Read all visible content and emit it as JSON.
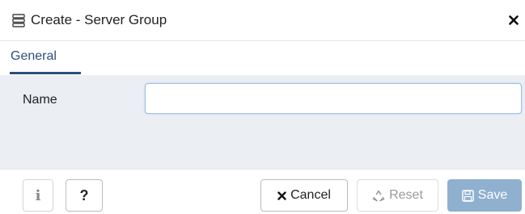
{
  "dialog": {
    "title": "Create - Server Group",
    "title_icon": "server-group-icon",
    "close_icon": "close-icon"
  },
  "tabs": [
    {
      "label": "General",
      "active": true
    }
  ],
  "form": {
    "name_label": "Name",
    "name_value": ""
  },
  "footer": {
    "info_label": "i",
    "help_label": "?",
    "cancel_label": "Cancel",
    "reset_label": "Reset",
    "save_label": "Save",
    "cancel_icon": "x-icon",
    "reset_icon": "recycle-icon",
    "save_icon": "floppy-disk-icon"
  },
  "colors": {
    "accent": "#2c4f7b",
    "panel_bg": "#ebeef3",
    "save_bg": "#8fb0cf",
    "input_border": "#9dc2e4"
  }
}
